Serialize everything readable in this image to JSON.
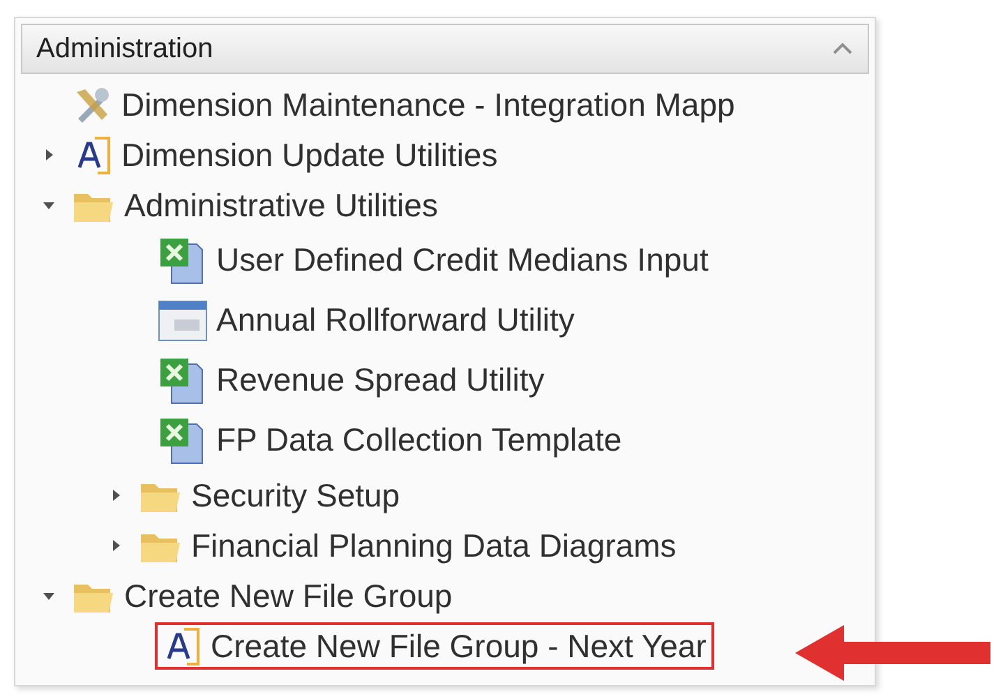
{
  "panel": {
    "title": "Administration",
    "expanded": true
  },
  "tree": [
    {
      "label": "Dimension Maintenance - Integration Mapp",
      "kind": "tools",
      "highlighted": false
    },
    {
      "label": "Dimension Update Utilities",
      "kind": "app",
      "expanded": false,
      "highlighted": false
    },
    {
      "label": "Administrative Utilities",
      "kind": "folder",
      "expanded": true,
      "highlighted": false,
      "children": [
        {
          "label": "User Defined Credit Medians Input",
          "kind": "excel",
          "highlighted": false
        },
        {
          "label": "Annual Rollforward Utility",
          "kind": "form",
          "highlighted": false
        },
        {
          "label": "Revenue Spread Utility",
          "kind": "excel",
          "highlighted": false
        },
        {
          "label": "FP Data Collection Template",
          "kind": "excel",
          "highlighted": false
        },
        {
          "label": "Security Setup",
          "kind": "folder",
          "expanded": false,
          "highlighted": false
        },
        {
          "label": "Financial Planning Data Diagrams",
          "kind": "folder",
          "expanded": false,
          "highlighted": false
        }
      ]
    },
    {
      "label": "Create New File Group",
      "kind": "folder",
      "expanded": true,
      "highlighted": false,
      "children": [
        {
          "label": "Create New File Group - Next Year",
          "kind": "app",
          "highlighted": true
        }
      ]
    }
  ]
}
